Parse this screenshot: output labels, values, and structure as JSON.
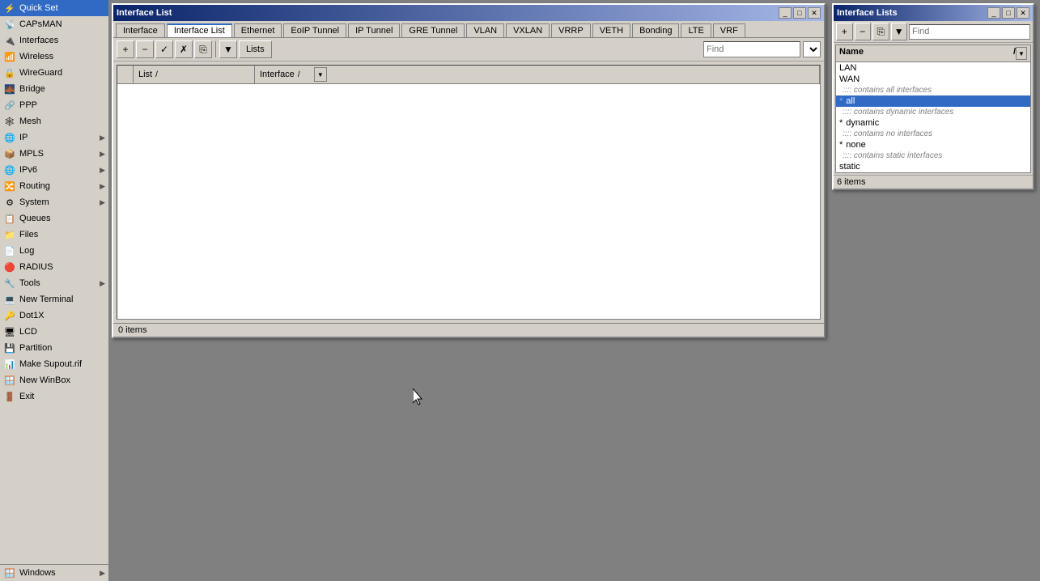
{
  "sidebar": {
    "items": [
      {
        "id": "quick-set",
        "label": "Quick Set",
        "icon": "⚡",
        "hasArrow": false
      },
      {
        "id": "capsman",
        "label": "CAPsMAN",
        "icon": "📡",
        "hasArrow": false
      },
      {
        "id": "interfaces",
        "label": "Interfaces",
        "icon": "🔌",
        "hasArrow": false,
        "active": true
      },
      {
        "id": "wireless",
        "label": "Wireless",
        "icon": "📶",
        "hasArrow": false
      },
      {
        "id": "wireguard",
        "label": "WireGuard",
        "icon": "🔒",
        "hasArrow": false
      },
      {
        "id": "bridge",
        "label": "Bridge",
        "icon": "🌉",
        "hasArrow": false
      },
      {
        "id": "ppp",
        "label": "PPP",
        "icon": "🔗",
        "hasArrow": false
      },
      {
        "id": "mesh",
        "label": "Mesh",
        "icon": "🕸",
        "hasArrow": false
      },
      {
        "id": "ip",
        "label": "IP",
        "icon": "🌐",
        "hasArrow": true
      },
      {
        "id": "mpls",
        "label": "MPLS",
        "icon": "📦",
        "hasArrow": true
      },
      {
        "id": "ipv6",
        "label": "IPv6",
        "icon": "🌐",
        "hasArrow": true
      },
      {
        "id": "routing",
        "label": "Routing",
        "icon": "🔀",
        "hasArrow": true
      },
      {
        "id": "system",
        "label": "System",
        "icon": "⚙",
        "hasArrow": true
      },
      {
        "id": "queues",
        "label": "Queues",
        "icon": "📋",
        "hasArrow": false
      },
      {
        "id": "files",
        "label": "Files",
        "icon": "📁",
        "hasArrow": false
      },
      {
        "id": "log",
        "label": "Log",
        "icon": "📄",
        "hasArrow": false
      },
      {
        "id": "radius",
        "label": "RADIUS",
        "icon": "🔴",
        "hasArrow": false
      },
      {
        "id": "tools",
        "label": "Tools",
        "icon": "🔧",
        "hasArrow": true
      },
      {
        "id": "new-terminal",
        "label": "New Terminal",
        "icon": "💻",
        "hasArrow": false
      },
      {
        "id": "dot1x",
        "label": "Dot1X",
        "icon": "🔑",
        "hasArrow": false
      },
      {
        "id": "lcd",
        "label": "LCD",
        "icon": "🖥",
        "hasArrow": false
      },
      {
        "id": "partition",
        "label": "Partition",
        "icon": "💾",
        "hasArrow": false
      },
      {
        "id": "make-supout",
        "label": "Make Supout.rif",
        "icon": "📊",
        "hasArrow": false
      },
      {
        "id": "new-winbox",
        "label": "New WinBox",
        "icon": "🪟",
        "hasArrow": false
      },
      {
        "id": "exit",
        "label": "Exit",
        "icon": "🚪",
        "hasArrow": false
      }
    ],
    "bottom_items": [
      {
        "id": "windows",
        "label": "Windows",
        "icon": "🪟",
        "hasArrow": true
      }
    ]
  },
  "main_window": {
    "title": "Interface List",
    "tabs": [
      {
        "id": "interface",
        "label": "Interface"
      },
      {
        "id": "interface-list",
        "label": "Interface List",
        "active": true
      },
      {
        "id": "ethernet",
        "label": "Ethernet"
      },
      {
        "id": "eoip-tunnel",
        "label": "EoIP Tunnel"
      },
      {
        "id": "ip-tunnel",
        "label": "IP Tunnel"
      },
      {
        "id": "gre-tunnel",
        "label": "GRE Tunnel"
      },
      {
        "id": "vlan",
        "label": "VLAN"
      },
      {
        "id": "vxlan",
        "label": "VXLAN"
      },
      {
        "id": "vrrp",
        "label": "VRRP"
      },
      {
        "id": "veth",
        "label": "VETH"
      },
      {
        "id": "bonding",
        "label": "Bonding"
      },
      {
        "id": "lte",
        "label": "LTE"
      },
      {
        "id": "vrf",
        "label": "VRF"
      }
    ],
    "toolbar": {
      "add_btn": "+",
      "remove_btn": "−",
      "enable_btn": "✓",
      "disable_btn": "✗",
      "copy_btn": "⎘",
      "filter_btn": "▼",
      "lists_btn": "Lists",
      "search_placeholder": "Find",
      "search_value": ""
    },
    "table": {
      "columns": [
        {
          "id": "flag",
          "label": ""
        },
        {
          "id": "list",
          "label": "List"
        },
        {
          "id": "interface",
          "label": "Interface"
        }
      ],
      "rows": []
    },
    "status": "0 items"
  },
  "secondary_window": {
    "title": "Interface Lists",
    "toolbar": {
      "add_btn": "+",
      "remove_btn": "−",
      "copy_btn": "⎘",
      "filter_btn": "▼",
      "search_placeholder": "Find",
      "search_value": ""
    },
    "table": {
      "columns": [
        {
          "id": "name",
          "label": "Name"
        }
      ],
      "rows": [
        {
          "name": "LAN",
          "type": "entry",
          "dot_color": "#000"
        },
        {
          "name": "WAN",
          "type": "entry",
          "dot_color": "#000"
        },
        {
          "name": ":::: contains all interfaces",
          "type": "comment"
        },
        {
          "name": "all",
          "type": "entry",
          "active": true,
          "dot_color": "#316ac5"
        },
        {
          "name": ":::: contains dynamic interfaces",
          "type": "comment"
        },
        {
          "name": "dynamic",
          "type": "entry",
          "dot_color": "#000"
        },
        {
          "name": ":::: contains no interfaces",
          "type": "comment"
        },
        {
          "name": "none",
          "type": "entry",
          "dot_color": "#000"
        },
        {
          "name": ":::: contains static interfaces",
          "type": "comment"
        },
        {
          "name": "static",
          "type": "entry",
          "dot_color": "#000"
        }
      ]
    },
    "status": "6 items"
  }
}
